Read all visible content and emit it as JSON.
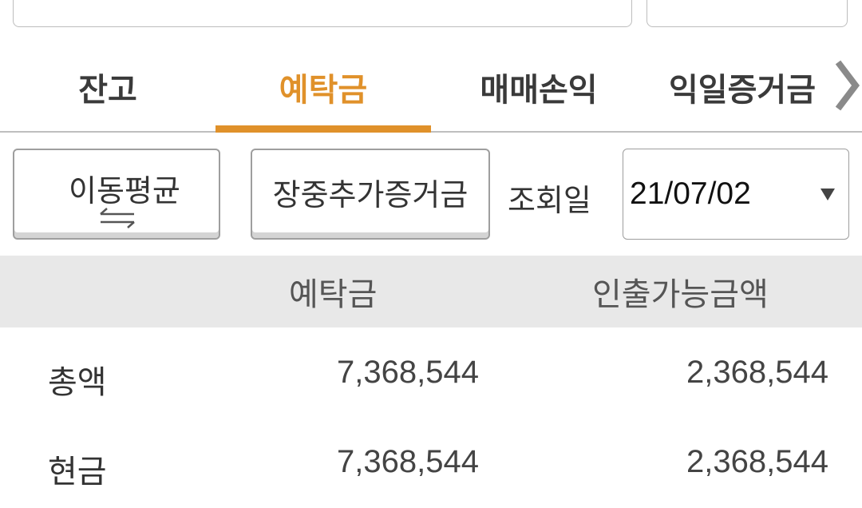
{
  "tabs": [
    {
      "label": "잔고"
    },
    {
      "label": "예탁금"
    },
    {
      "label": "매매손익"
    },
    {
      "label": "익일증거금"
    }
  ],
  "active_tab": "예탁금",
  "colors": {
    "accent": "#e0912a",
    "header_bg": "#e8e8e8"
  },
  "controls": {
    "moving_average_label": "이동평균",
    "additional_margin_label": "장중추가증거금",
    "query_date_label": "조회일",
    "query_date_value": "21/07/02"
  },
  "table": {
    "columns": [
      "예탁금",
      "인출가능금액"
    ],
    "rows": [
      {
        "label": "총액",
        "deposit": "7,368,544",
        "withdrawable": "2,368,544"
      },
      {
        "label": "현금",
        "deposit": "7,368,544",
        "withdrawable": "2,368,544"
      }
    ]
  }
}
